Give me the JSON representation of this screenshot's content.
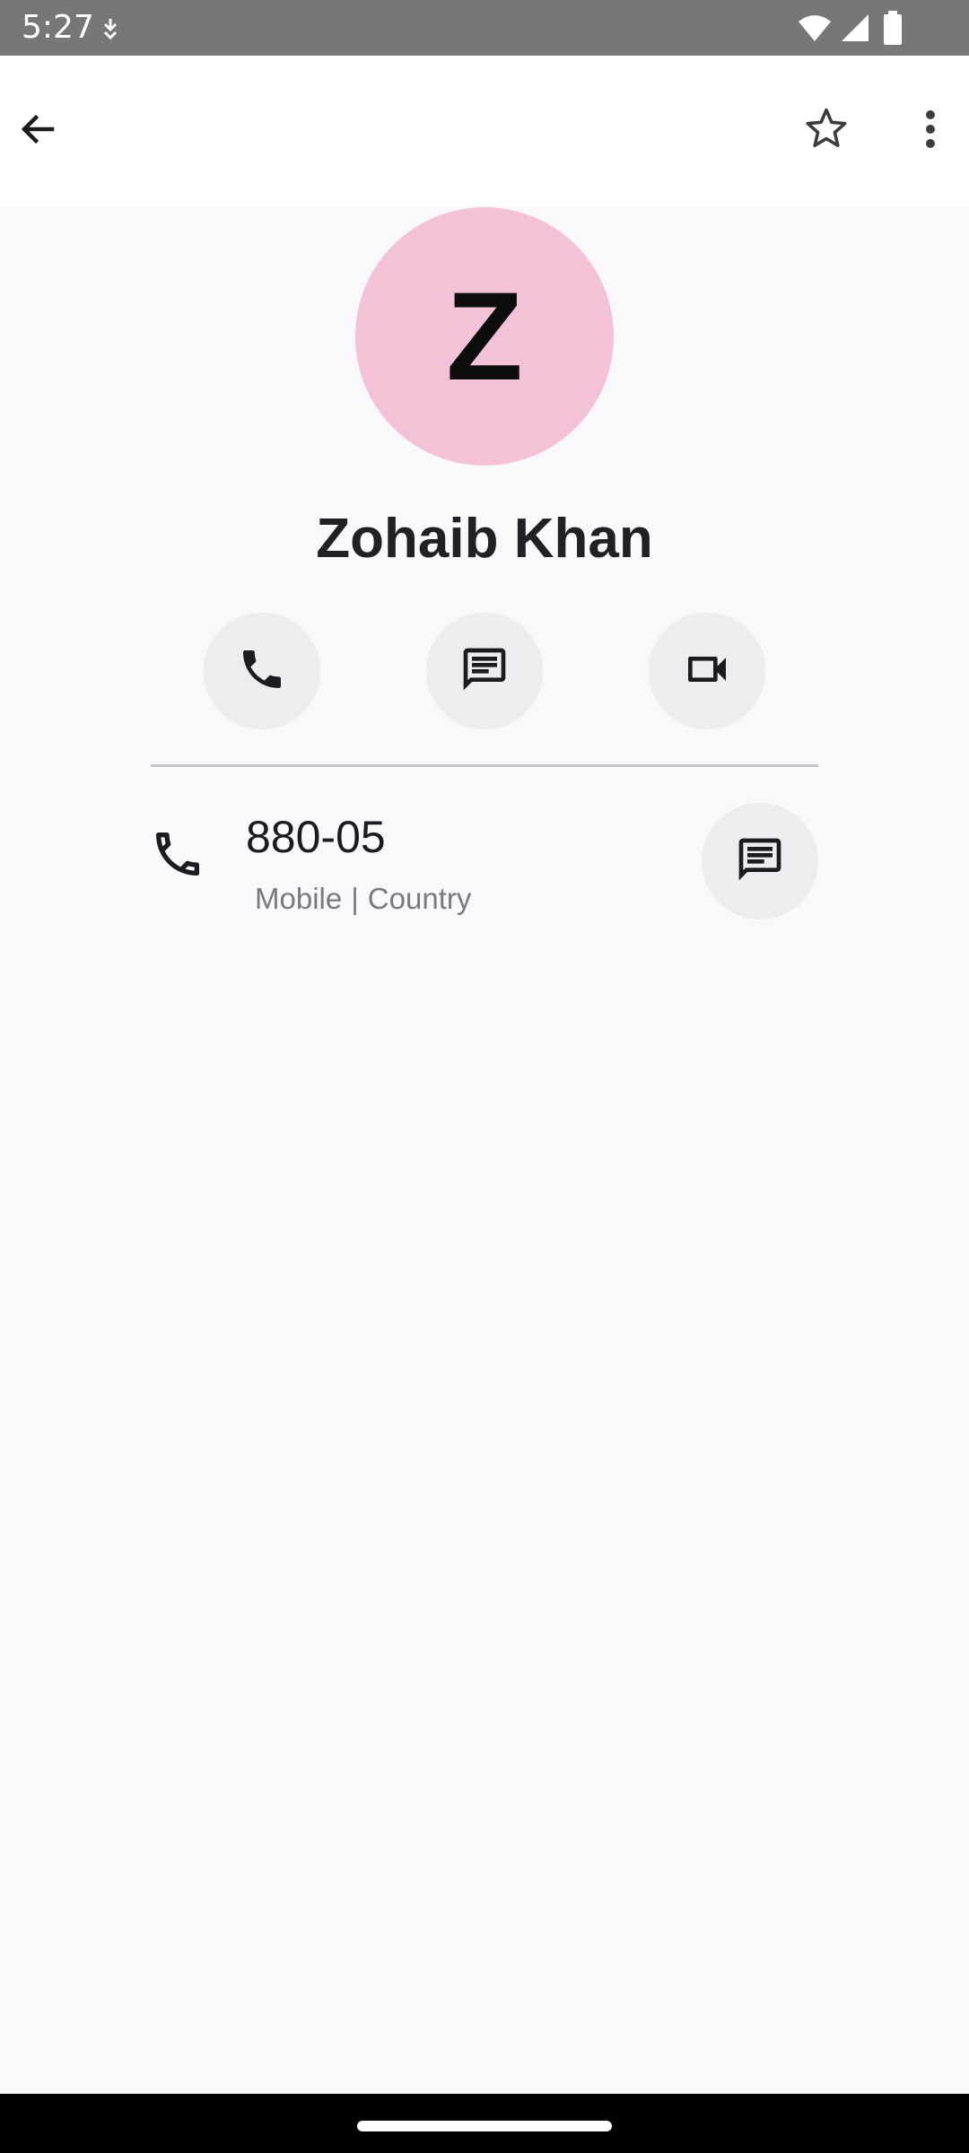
{
  "status_bar": {
    "time": "5:27",
    "icons": [
      "download-icon",
      "wifi-icon",
      "signal-icon",
      "battery-icon"
    ]
  },
  "app_bar": {
    "icons": [
      "back-arrow-icon",
      "star-outline-icon",
      "more-vert-icon"
    ]
  },
  "contact": {
    "initial": "Z",
    "name": "Zohaib Khan",
    "avatar_color": "#f4c2d8"
  },
  "actions": [
    {
      "icon": "phone-icon"
    },
    {
      "icon": "message-icon"
    },
    {
      "icon": "video-call-icon"
    }
  ],
  "phone_entry": {
    "number": "880-05",
    "type": "Mobile",
    "separator": "|",
    "label": "Country",
    "icons": [
      "phone-icon",
      "message-icon"
    ]
  },
  "colors": {
    "background": "#f9f9fc",
    "status_bar": "#777777",
    "action_circle": "#ededf0",
    "secondary_text": "#7a7a7e"
  }
}
